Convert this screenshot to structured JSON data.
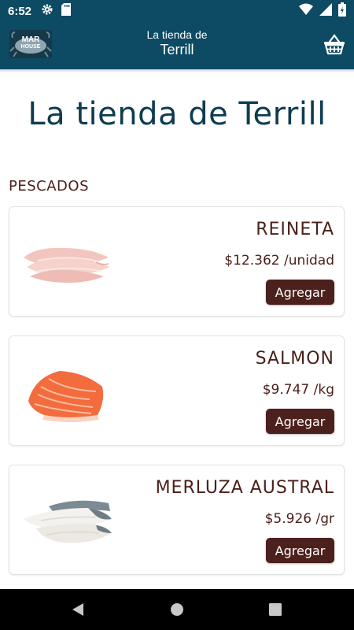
{
  "status_bar": {
    "time": "6:52",
    "icons": [
      "gear-icon",
      "sd-card-icon",
      "wifi-icon",
      "signal-icon",
      "battery-icon"
    ]
  },
  "app_bar": {
    "logo_text_line1": "MAR",
    "logo_text_line2": "HOUSE",
    "title_line1": "La tienda de",
    "title_line2": "Terrill",
    "cart_icon": "shopping-basket-icon"
  },
  "page": {
    "heading": "La tienda de Terrill",
    "section_title": "PESCADOS"
  },
  "products": [
    {
      "name": "REINETA",
      "price": "$12.362 /unidad",
      "button": "Agregar",
      "image": "reineta-fillet"
    },
    {
      "name": "SALMON",
      "price": "$9.747 /kg",
      "button": "Agregar",
      "image": "salmon-fillet"
    },
    {
      "name": "MERLUZA AUSTRAL",
      "price": "$5.926 /gr",
      "button": "Agregar",
      "image": "merluza-fillet"
    }
  ],
  "nav_bar": {
    "icons": [
      "back-icon",
      "home-icon",
      "recents-icon"
    ]
  },
  "colors": {
    "primary": "#0d4a63",
    "heading": "#0e3c52",
    "accent_brown": "#4c201c",
    "text_brown": "#4a1f1a"
  }
}
